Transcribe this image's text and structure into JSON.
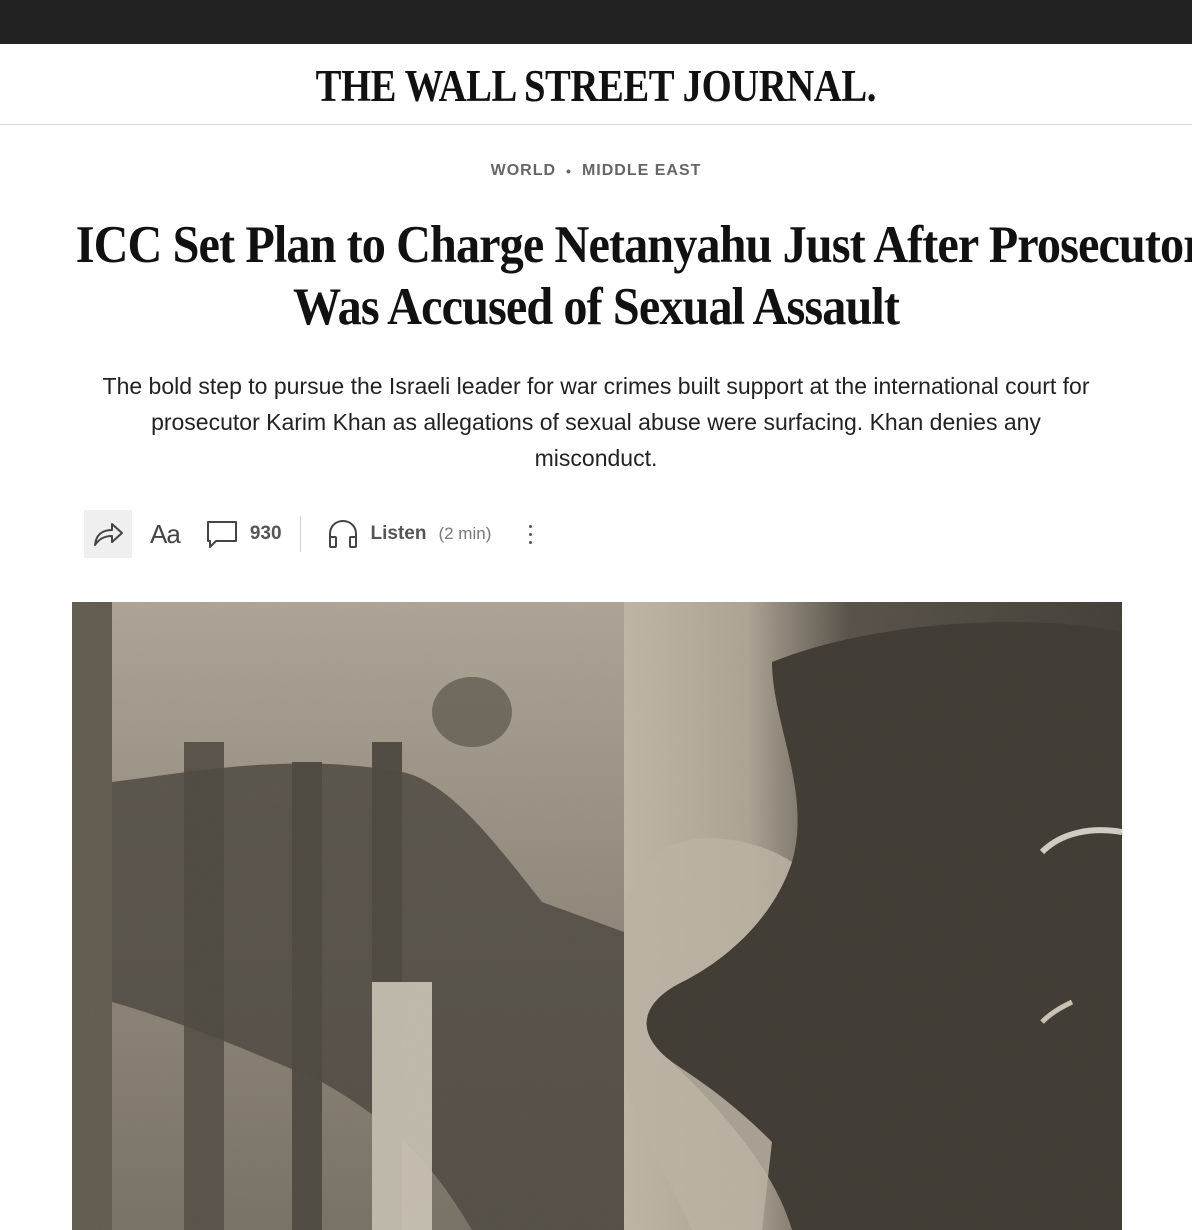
{
  "masthead": {
    "title": "THE WALL STREET JOURNAL."
  },
  "breadcrumb": {
    "section": "WORLD",
    "subsection": "MIDDLE EAST"
  },
  "article": {
    "headline_line1": "ICC Set Plan to Charge Netanyahu Just After Prosecutor",
    "headline_line2": "Was Accused of Sexual Assault",
    "dek": "The bold step to pursue the Israeli leader for war crimes built support at the international court for prosecutor Karim Khan as allegations of sexual abuse were surfacing. Khan denies any misconduct."
  },
  "toolbar": {
    "share_icon": "share-arrow-icon",
    "font_label": "Aa",
    "comments_icon": "speech-bubble-icon",
    "comments_count": "930",
    "listen_icon": "headphones-icon",
    "listen_label": "Listen",
    "listen_duration": "(2 min)",
    "more_icon": "vertical-ellipsis-icon"
  },
  "colors": {
    "topbar": "#222222",
    "text": "#111111",
    "muted": "#666666",
    "toolbar_bg": "#efefef"
  }
}
